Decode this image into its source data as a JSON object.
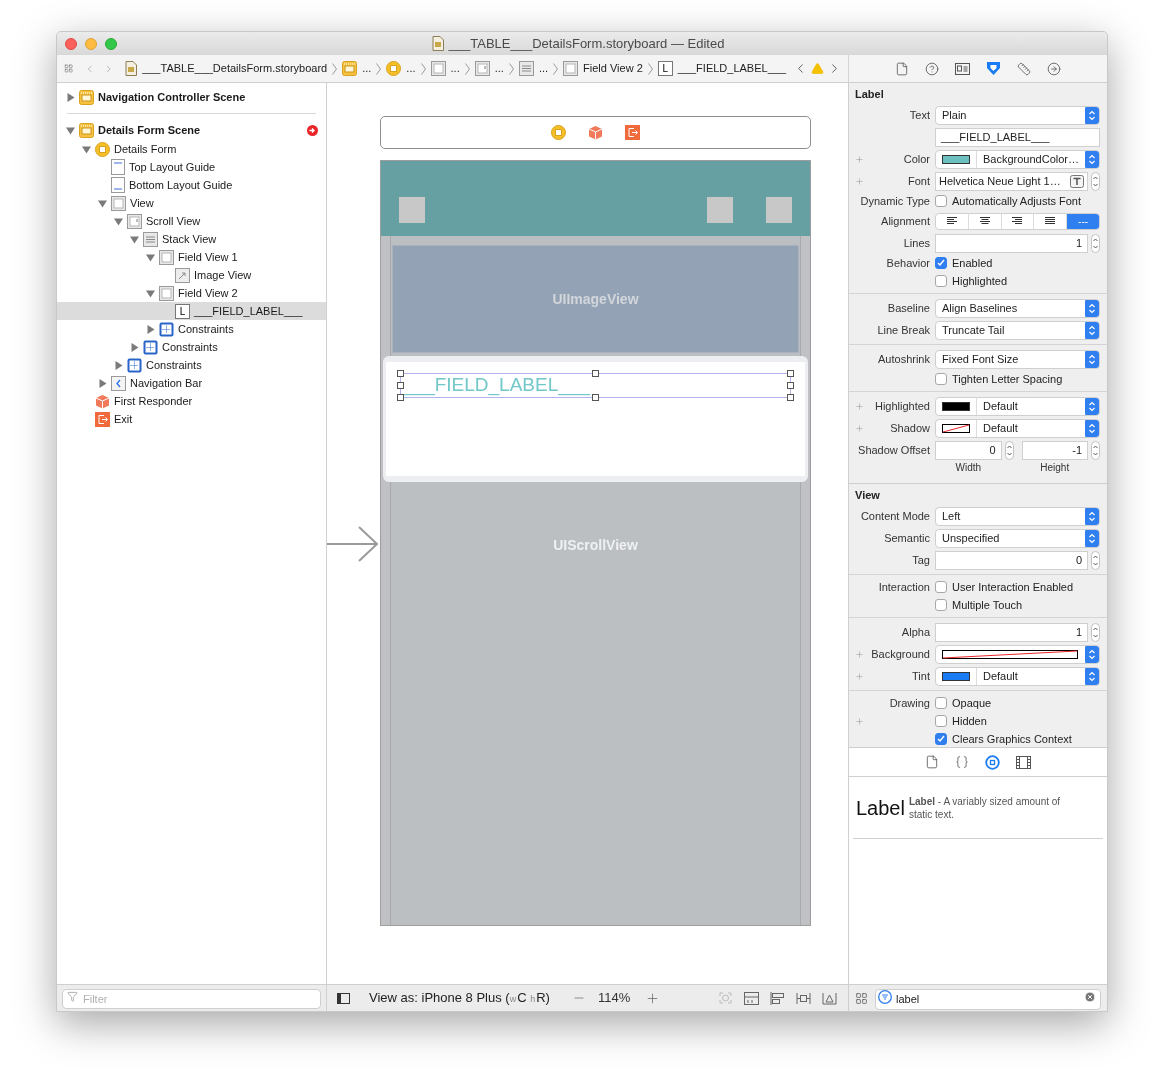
{
  "window": {
    "title": "___TABLE___DetailsForm.storyboard — Edited"
  },
  "jump_bar": {
    "items": [
      {
        "kind": "storyboard",
        "label": "___TABLE___DetailsForm.storyboard"
      },
      {
        "kind": "scene",
        "label": "..."
      },
      {
        "kind": "controller",
        "label": "..."
      },
      {
        "kind": "view",
        "label": "..."
      },
      {
        "kind": "scroll",
        "label": "..."
      },
      {
        "kind": "stack",
        "label": "..."
      },
      {
        "kind": "view",
        "label": "Field View 2"
      },
      {
        "kind": "label",
        "glyph": "L",
        "label": "___FIELD_LABEL___"
      }
    ]
  },
  "inspector_tabs": [
    {
      "kind": "file",
      "selected": false
    },
    {
      "kind": "help",
      "selected": false
    },
    {
      "kind": "identity",
      "selected": false
    },
    {
      "kind": "attributes",
      "selected": true
    },
    {
      "kind": "size",
      "selected": false
    },
    {
      "kind": "connections",
      "selected": false
    }
  ],
  "outline": {
    "items": [
      {
        "kind": "scene",
        "label": "Navigation Controller Scene",
        "expanded": false
      },
      {
        "kind": "scene",
        "label": "Details Form Scene",
        "expanded": true,
        "warning": true,
        "children": [
          {
            "kind": "controller",
            "label": "Details Form",
            "expanded": true,
            "children": [
              {
                "kind": "top-guide",
                "label": "Top Layout Guide"
              },
              {
                "kind": "bottom-guide",
                "label": "Bottom Layout Guide"
              },
              {
                "kind": "view",
                "label": "View",
                "expanded": true,
                "children": [
                  {
                    "kind": "scroll",
                    "label": "Scroll View",
                    "expanded": true,
                    "children": [
                      {
                        "kind": "stack",
                        "label": "Stack View",
                        "expanded": true,
                        "children": [
                          {
                            "kind": "view",
                            "label": "Field View 1",
                            "expanded": true,
                            "children": [
                              {
                                "kind": "image",
                                "label": "Image View"
                              }
                            ]
                          },
                          {
                            "kind": "view",
                            "label": "Field View 2",
                            "expanded": true,
                            "children": [
                              {
                                "kind": "label",
                                "glyph": "L",
                                "label": "___FIELD_LABEL___",
                                "selected": true
                              }
                            ]
                          },
                          {
                            "kind": "constraints",
                            "label": "Constraints",
                            "expanded": false
                          }
                        ]
                      },
                      {
                        "kind": "constraints",
                        "label": "Constraints",
                        "expanded": false
                      }
                    ]
                  },
                  {
                    "kind": "constraints",
                    "label": "Constraints",
                    "expanded": false
                  }
                ]
              },
              {
                "kind": "navbar",
                "label": "Navigation Bar",
                "expanded": false
              }
            ]
          },
          {
            "kind": "responder",
            "label": "First Responder"
          },
          {
            "kind": "exit",
            "label": "Exit"
          }
        ]
      }
    ],
    "filter": {
      "placeholder": "Filter"
    }
  },
  "canvas": {
    "dock": [
      {
        "kind": "controller"
      },
      {
        "kind": "responder"
      },
      {
        "kind": "exit"
      }
    ],
    "bar_buttons": [
      {
        "kind": "left"
      },
      {
        "kind": "right"
      },
      {
        "kind": "right"
      }
    ],
    "image_view_title": "UIImageView",
    "label_text": "___FIELD_LABEL___",
    "label_selected": true,
    "scroll_view_title": "UIScrollView"
  },
  "canvas_bar": {
    "view_as": [
      {
        "text": "View as: iPhone 8 Plus (",
        "small": false
      },
      {
        "text": "w",
        "small": true
      },
      {
        "text": "C ",
        "small": false
      },
      {
        "text": "h",
        "small": true
      },
      {
        "text": "R)",
        "small": false
      }
    ],
    "zoom": "114%"
  },
  "inspector": {
    "sections": [
      {
        "title": "Label",
        "groups": [
          [
            {
              "kind": "popup",
              "label": "Text",
              "value": "Plain"
            },
            {
              "kind": "text",
              "value": "___FIELD_LABEL___"
            },
            {
              "kind": "color",
              "label": "Color",
              "addable": true,
              "color": "#6cc0c0",
              "value": "BackgroundColor…"
            },
            {
              "kind": "font",
              "label": "Font",
              "addable": true,
              "value": "Helvetica Neue Light 1…"
            },
            {
              "kind": "checkbox",
              "label": "Dynamic Type",
              "text": "Automatically Adjusts Font",
              "checked": false
            },
            {
              "kind": "segmented",
              "label": "Alignment",
              "segments": [
                {
                  "kind": "left",
                  "selected": false
                },
                {
                  "kind": "center",
                  "selected": false
                },
                {
                  "kind": "right",
                  "selected": false
                },
                {
                  "kind": "justified",
                  "selected": false
                },
                {
                  "kind": "natural",
                  "selected": true,
                  "text": "---"
                }
              ]
            },
            {
              "kind": "number",
              "label": "Lines",
              "value": "1"
            },
            {
              "kind": "checkbox",
              "label": "Behavior",
              "text": "Enabled",
              "checked": true
            },
            {
              "kind": "checkbox",
              "text": "Highlighted",
              "checked": false
            }
          ],
          [
            {
              "kind": "popup",
              "label": "Baseline",
              "value": "Align Baselines"
            },
            {
              "kind": "popup",
              "label": "Line Break",
              "value": "Truncate Tail"
            }
          ],
          [
            {
              "kind": "popup",
              "label": "Autoshrink",
              "value": "Fixed Font Size"
            },
            {
              "kind": "checkbox",
              "text": "Tighten Letter Spacing",
              "checked": false
            }
          ],
          [
            {
              "kind": "color",
              "label": "Highlighted",
              "addable": true,
              "color": "#000000",
              "value": "Default"
            },
            {
              "kind": "color",
              "label": "Shadow",
              "addable": true,
              "clear": true,
              "value": "Default"
            },
            {
              "kind": "offset",
              "label": "Shadow Offset",
              "fields": [
                {
                  "value": "0",
                  "caption": "Width"
                },
                {
                  "value": "-1",
                  "caption": "Height"
                }
              ]
            }
          ]
        ]
      },
      {
        "title": "View",
        "groups": [
          [
            {
              "kind": "popup",
              "label": "Content Mode",
              "value": "Left"
            },
            {
              "kind": "popup",
              "label": "Semantic",
              "value": "Unspecified"
            },
            {
              "kind": "number",
              "label": "Tag",
              "value": "0"
            }
          ],
          [
            {
              "kind": "checkbox",
              "label": "Interaction",
              "text": "User Interaction Enabled",
              "checked": false
            },
            {
              "kind": "checkbox",
              "text": "Multiple Touch",
              "checked": false
            }
          ],
          [
            {
              "kind": "number",
              "label": "Alpha",
              "value": "1"
            },
            {
              "kind": "color",
              "label": "Background",
              "addable": true,
              "clear": true
            },
            {
              "kind": "color",
              "label": "Tint",
              "addable": true,
              "color": "#1a7cf5",
              "value": "Default"
            }
          ],
          [
            {
              "kind": "checkbox",
              "label": "Drawing",
              "text": "Opaque",
              "checked": false
            },
            {
              "kind": "checkbox",
              "text": "Hidden",
              "checked": false,
              "addable": true
            },
            {
              "kind": "checkbox",
              "text": "Clears Graphics Context",
              "checked": true
            }
          ]
        ]
      }
    ]
  },
  "library": {
    "tabs": [
      {
        "kind": "file",
        "selected": false
      },
      {
        "kind": "code",
        "selected": false
      },
      {
        "kind": "object",
        "selected": true
      },
      {
        "kind": "media",
        "selected": false
      }
    ],
    "items": [
      {
        "preview": "Label",
        "description": "**Label** - A variably sized amount of static text."
      }
    ],
    "search": {
      "value": "label"
    }
  }
}
